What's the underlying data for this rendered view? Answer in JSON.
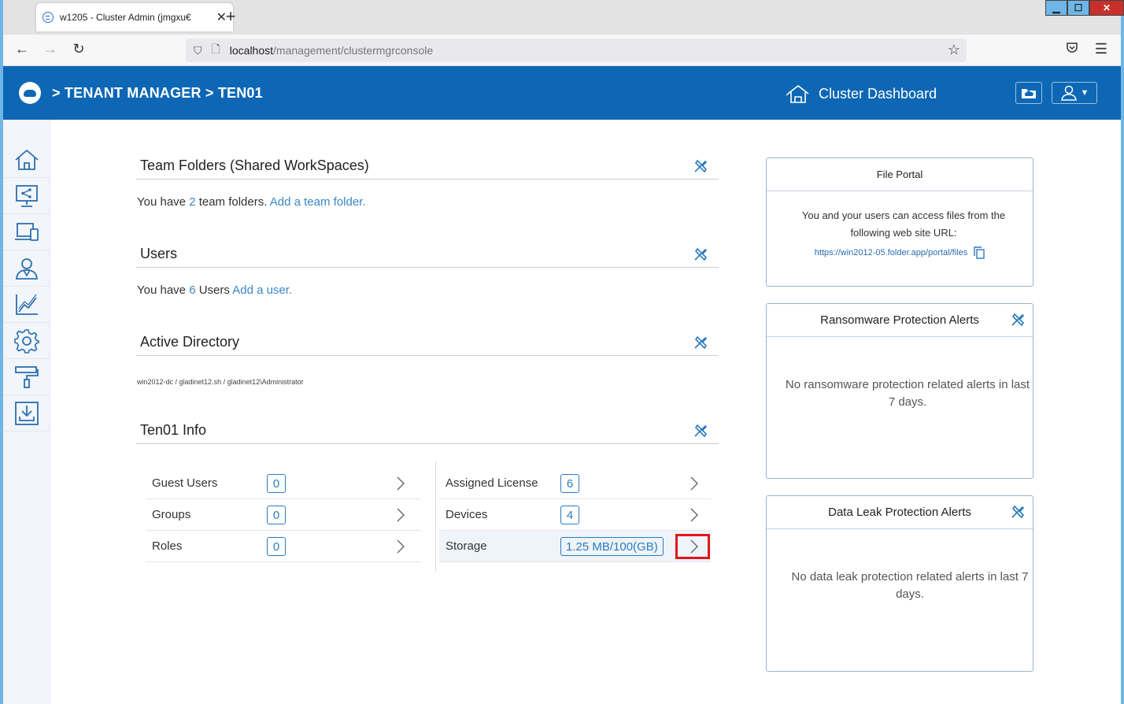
{
  "browser": {
    "tab_title": "w1205 - Cluster Admin (jmgxu€",
    "url_host": "localhost",
    "url_path": "/management/clustermgrconsole"
  },
  "header": {
    "breadcrumb": "> TENANT MANAGER > TEN01",
    "dashboard_label": "Cluster Dashboard",
    "colors": {
      "header_bg": "#0d67b5",
      "accent": "#3a86c8",
      "highlight": "#e0161c"
    }
  },
  "sidebar": {
    "items": [
      "home-icon",
      "share-monitor-icon",
      "devices-icon",
      "users-icon",
      "chart-icon",
      "gear-icon",
      "paint-roller-icon",
      "download-icon"
    ]
  },
  "team_folders": {
    "title": "Team Folders (Shared WorkSpaces)",
    "text_prefix": "You have",
    "count": "2",
    "text_suffix": "team folders.",
    "link": "Add a team folder."
  },
  "users": {
    "title": "Users",
    "text_prefix": "You have",
    "count": "6",
    "text_suffix": "Users",
    "link": "Add a user."
  },
  "active_directory": {
    "title": "Active Directory",
    "text": "win2012-dc / gladinet12.sh / gladinet12\\Administrator"
  },
  "info": {
    "title": "Ten01 Info",
    "left": [
      {
        "label": "Guest Users",
        "value": "0"
      },
      {
        "label": "Groups",
        "value": "0"
      },
      {
        "label": "Roles",
        "value": "0"
      }
    ],
    "right": [
      {
        "label": "Assigned License",
        "value": "6"
      },
      {
        "label": "Devices",
        "value": "4"
      },
      {
        "label": "Storage",
        "value": "1.25 MB/100(GB)"
      }
    ]
  },
  "file_portal": {
    "title": "File Portal",
    "text": "You and your users can access files from the following web site URL:",
    "url": "https://win2012-05.folder.app/portal/files"
  },
  "ransomware": {
    "title": "Ransomware Protection Alerts",
    "text": "No ransomware protection related alerts in last 7 days."
  },
  "dlp": {
    "title": "Data Leak Protection Alerts",
    "text": "No data leak protection related alerts in last 7 days."
  }
}
